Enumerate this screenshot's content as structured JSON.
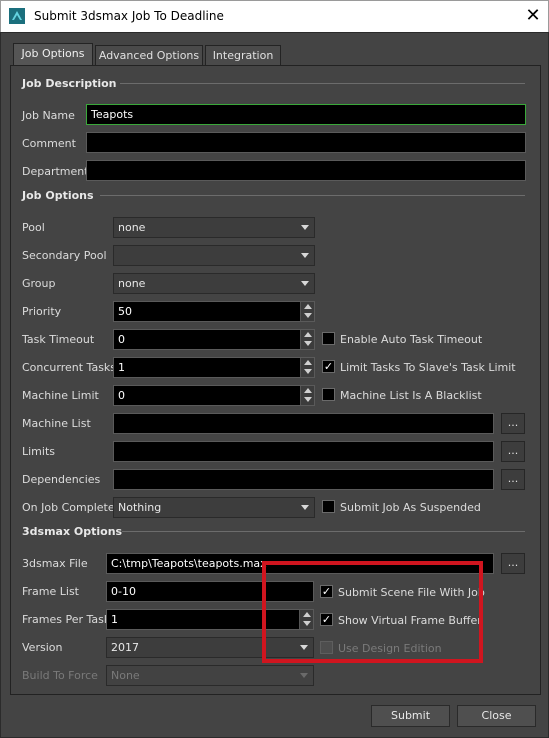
{
  "window": {
    "title": "Submit 3dsmax Job To Deadline",
    "close_glyph": "✕",
    "app_icon": "3dsmax-icon"
  },
  "tabs": [
    {
      "label": "Job Options",
      "active": true
    },
    {
      "label": "Advanced Options",
      "active": false
    },
    {
      "label": "Integration",
      "active": false
    }
  ],
  "job_description": {
    "heading": "Job Description",
    "job_name_label": "Job Name",
    "job_name_value": "Teapots",
    "comment_label": "Comment",
    "comment_value": "",
    "department_label": "Department",
    "department_value": ""
  },
  "job_options": {
    "heading": "Job Options",
    "pool_label": "Pool",
    "pool_value": "none",
    "secondary_pool_label": "Secondary Pool",
    "secondary_pool_value": "",
    "group_label": "Group",
    "group_value": "none",
    "priority_label": "Priority",
    "priority_value": "50",
    "task_timeout_label": "Task Timeout",
    "task_timeout_value": "0",
    "enable_auto_timeout_label": "Enable Auto Task Timeout",
    "enable_auto_timeout_checked": false,
    "concurrent_tasks_label": "Concurrent Tasks",
    "concurrent_tasks_value": "1",
    "limit_tasks_label": "Limit Tasks To Slave's Task Limit",
    "limit_tasks_checked": true,
    "machine_limit_label": "Machine Limit",
    "machine_limit_value": "0",
    "machine_list_blacklist_label": "Machine List Is A Blacklist",
    "machine_list_blacklist_checked": false,
    "machine_list_label": "Machine List",
    "machine_list_value": "",
    "limits_label": "Limits",
    "limits_value": "",
    "dependencies_label": "Dependencies",
    "dependencies_value": "",
    "on_job_complete_label": "On Job Complete",
    "on_job_complete_value": "Nothing",
    "submit_suspended_label": "Submit Job As Suspended",
    "submit_suspended_checked": false,
    "browse_label": "..."
  },
  "max_options": {
    "heading": "3dsmax Options",
    "max_file_label": "3dsmax File",
    "max_file_value": "C:\\tmp\\Teapots\\teapots.max",
    "frame_list_label": "Frame List",
    "frame_list_value": "0-10",
    "submit_scene_label": "Submit Scene File With Job",
    "submit_scene_checked": true,
    "frames_per_task_label": "Frames Per Task",
    "frames_per_task_value": "1",
    "show_vfb_label": "Show Virtual Frame Buffer",
    "show_vfb_checked": true,
    "version_label": "Version",
    "version_value": "2017",
    "design_edition_label": "Use Design Edition",
    "design_edition_checked": false,
    "build_to_force_label": "Build To Force",
    "build_to_force_value": "None",
    "browse_label": "..."
  },
  "footer": {
    "submit_label": "Submit",
    "close_label": "Close"
  },
  "checkmark_glyph": "✓",
  "highlight_color": "#d0151f"
}
